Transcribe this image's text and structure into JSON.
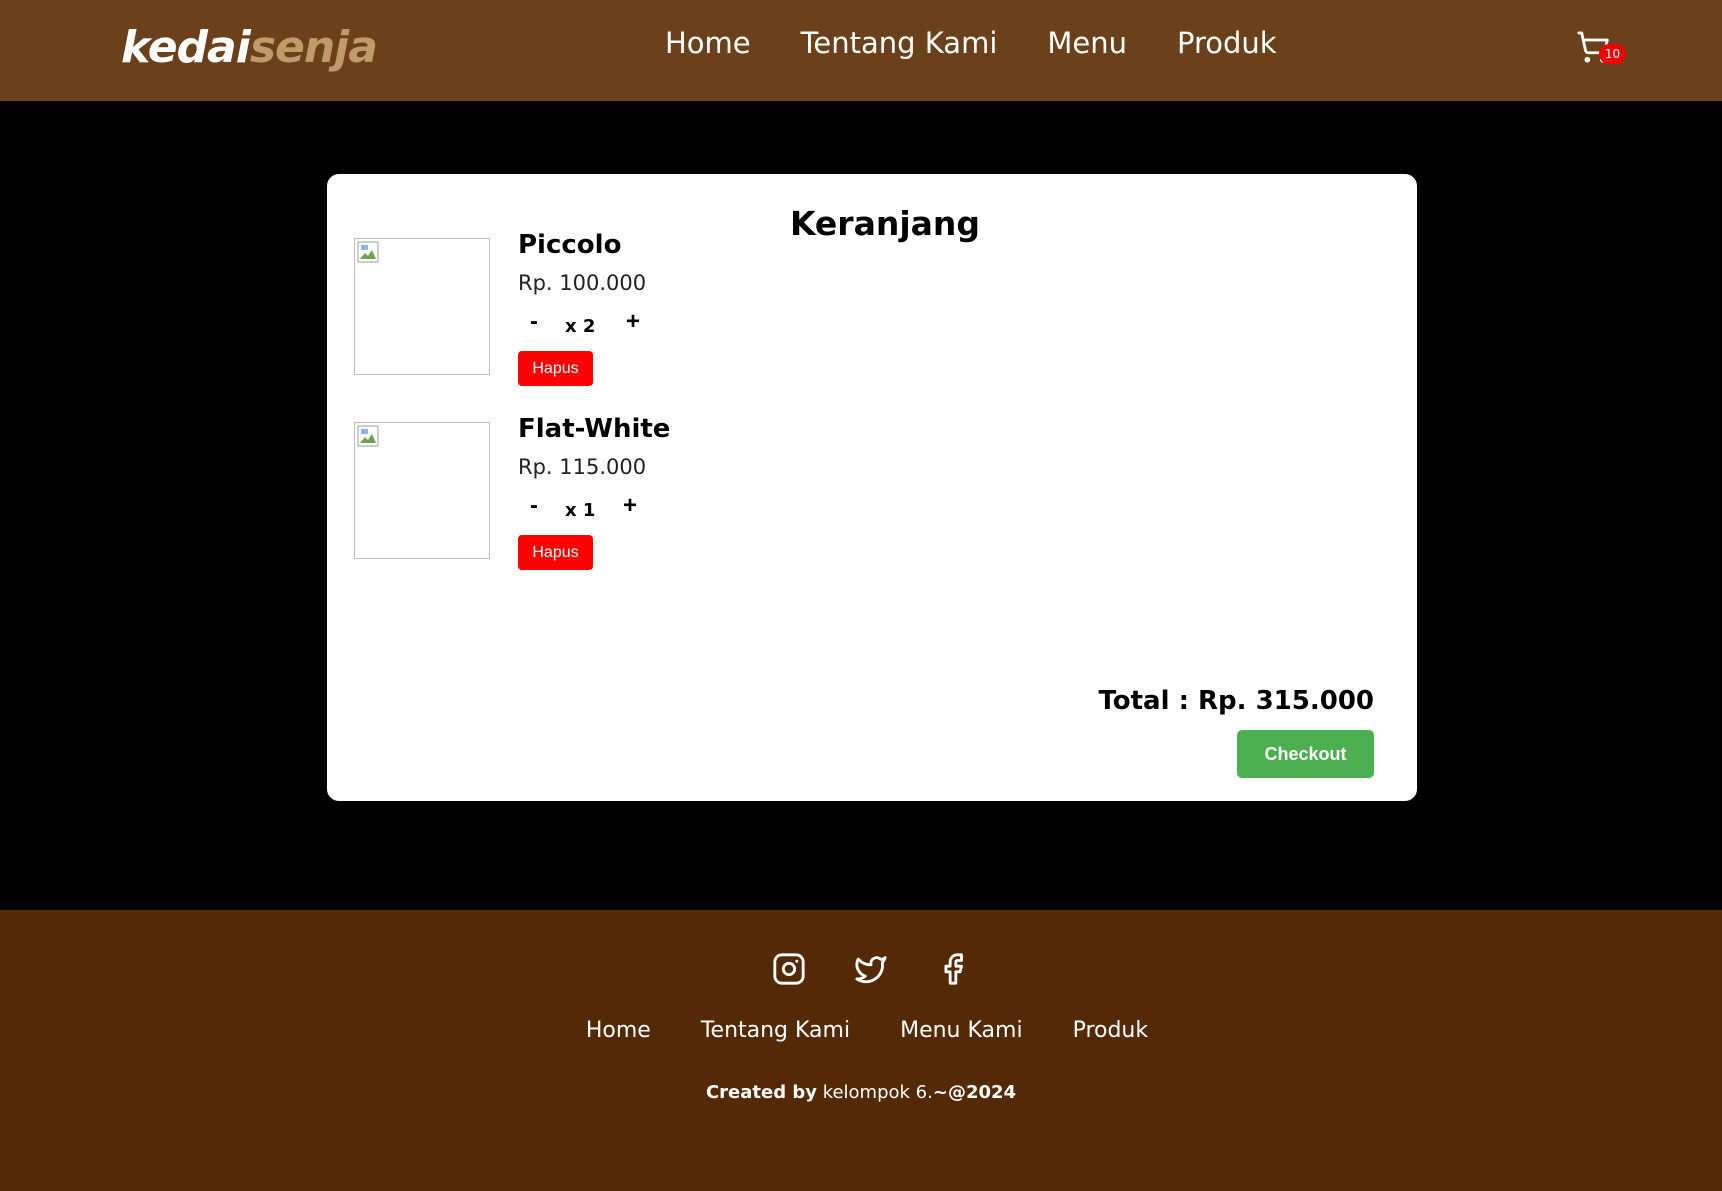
{
  "brand": {
    "part1": "kedai",
    "part2": "senja"
  },
  "nav": {
    "links": [
      "Home",
      "Tentang Kami",
      "Menu",
      "Produk"
    ],
    "cart_count": "10"
  },
  "cart": {
    "title": "Keranjang",
    "items": [
      {
        "name": "Piccolo",
        "price": "Rp. 100.000",
        "minus": "-",
        "qty": "x 2",
        "plus": "+",
        "remove": "Hapus"
      },
      {
        "name": "Flat-White",
        "price": "Rp. 115.000",
        "minus": "-",
        "qty": "x 1",
        "plus": "+",
        "remove": "Hapus"
      }
    ],
    "total": "Total : Rp. 315.000",
    "checkout": "Checkout"
  },
  "footer": {
    "socials": [
      "instagram-icon",
      "twitter-icon",
      "facebook-icon"
    ],
    "links": [
      "Home",
      "Tentang Kami",
      "Menu Kami",
      "Produk"
    ],
    "credit": {
      "prefix": "Created by",
      "author": " kelompok 6.",
      "suffix": "~@2024"
    }
  },
  "colors": {
    "navbar": "#6a411b",
    "footer": "#542905",
    "accent": "#c19a6b",
    "danger": "#ff0000",
    "success": "#4caf50"
  }
}
